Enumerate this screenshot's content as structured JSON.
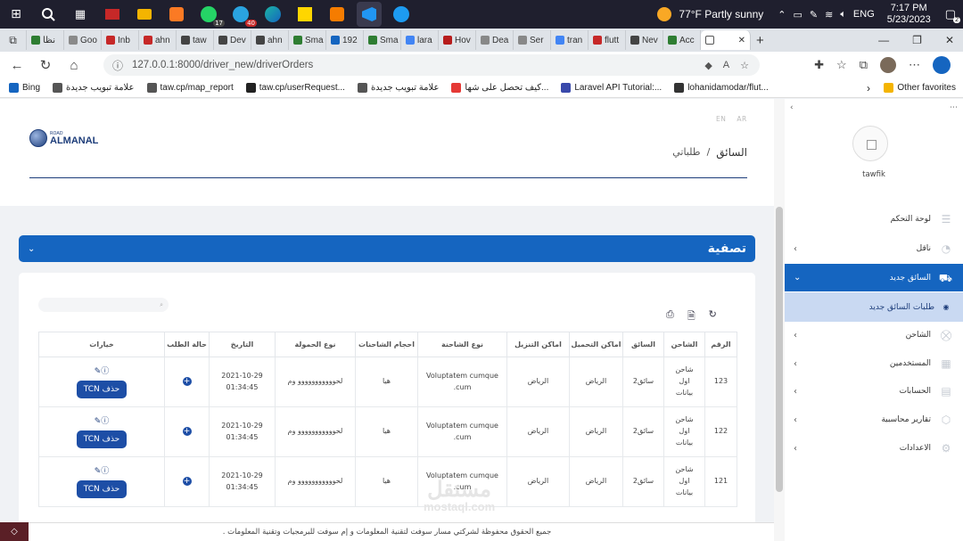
{
  "taskbar": {
    "icons": [
      "windows-icon",
      "search-icon",
      "task-view-icon",
      "app-icon",
      "file-explorer-icon",
      "xampp-icon",
      "whatsapp-icon",
      "telegram-icon",
      "edge-icon",
      "sticky-notes-icon",
      "office-icon",
      "vscode-icon",
      "twitter-icon"
    ],
    "whatsapp_badge": "17",
    "telegram_badge": "40",
    "weather": "77°F  Partly sunny",
    "lang": "ENG",
    "time": "7:17 PM",
    "date": "5/23/2023",
    "notif_badge": "2"
  },
  "tabs": [
    {
      "label": "نظا",
      "color": "#2e7d32"
    },
    {
      "label": "Goo",
      "color": "#8a8a8a"
    },
    {
      "label": "Inb",
      "color": "#c62828"
    },
    {
      "label": "ahn",
      "color": "#c62828"
    },
    {
      "label": "taw",
      "color": "#444"
    },
    {
      "label": "Dev",
      "color": "#444"
    },
    {
      "label": "ahn",
      "color": "#444"
    },
    {
      "label": "Sma",
      "color": "#2e7d32"
    },
    {
      "label": "192",
      "color": "#1565c0"
    },
    {
      "label": "Sma",
      "color": "#2e7d32"
    },
    {
      "label": "lara",
      "color": "#4285f4"
    },
    {
      "label": "Hov",
      "color": "#b71c1c"
    },
    {
      "label": "Dea",
      "color": "#888"
    },
    {
      "label": "Ser",
      "color": "#888"
    },
    {
      "label": "tran",
      "color": "#4285f4"
    },
    {
      "label": "flutt",
      "color": "#c62828"
    },
    {
      "label": "Nev",
      "color": "#444"
    },
    {
      "label": "Acc",
      "color": "#2e7d32"
    },
    {
      "label": "",
      "color": "#fff"
    }
  ],
  "address": {
    "url": "127.0.0.1:8000/driver_new/driverOrders"
  },
  "bookmarks": [
    {
      "label": "Bing",
      "color": "#1565c0"
    },
    {
      "label": "علامة تبويب جديدة",
      "color": "#555"
    },
    {
      "label": "taw.cp/map_report",
      "color": "#555"
    },
    {
      "label": "taw.cp/userRequest...",
      "color": "#222"
    },
    {
      "label": "علامة تبويب جديدة",
      "color": "#555"
    },
    {
      "label": "كيف تحصل على شها...",
      "color": "#e53935"
    },
    {
      "label": "Laravel API Tutorial:...",
      "color": "#3949ab"
    },
    {
      "label": "lohanidamodar/flut...",
      "color": "#333"
    }
  ],
  "other_favorites": "Other favorites",
  "header": {
    "lang_en": "EN",
    "lang_ar": "AR",
    "logo_small": "ROAD",
    "logo_text": "ALMANAL",
    "breadcrumb_root": "السائق",
    "breadcrumb_sep": "/",
    "breadcrumb_current": "طلباتي"
  },
  "filter": {
    "title": "تصفية"
  },
  "table": {
    "headers": [
      "الرقم",
      "الشاحن",
      "السائق",
      "اماكن التحميل",
      "اماكن التنزيل",
      "نوع الشاحنة",
      "احجام الشاحنات",
      "نوع الحمولة",
      "التاريخ",
      "حالة الطلب",
      "خيارات"
    ],
    "rows": [
      {
        "id": "123",
        "shipper": "شاحن اول بيانات",
        "driver": "سائق2",
        "load": "الرياض",
        "unload": "الرياض",
        "truck_type": "Voluptatem cumque .cum",
        "sizes": "هيا",
        "cargo": "لحووووووووووو وم",
        "date": "2021-10-29 01:34:45"
      },
      {
        "id": "122",
        "shipper": "شاحن اول بيانات",
        "driver": "سائق2",
        "load": "الرياض",
        "unload": "الرياض",
        "truck_type": "Voluptatem cumque .cum",
        "sizes": "هيا",
        "cargo": "لحووووووووووو وم",
        "date": "2021-10-29 01:34:45"
      },
      {
        "id": "121",
        "shipper": "شاحن اول بيانات",
        "driver": "سائق2",
        "load": "الرياض",
        "unload": "الرياض",
        "truck_type": "Voluptatem cumque .cum",
        "sizes": "هيا",
        "cargo": "لحووووووووووو وم",
        "date": "2021-10-29 01:34:45"
      }
    ],
    "delete_label": "حذف TCN"
  },
  "watermark": {
    "line1": "مستقل",
    "line2": "mostaql.com"
  },
  "footer": {
    "text": "جميع الحقوق محفوظة لشركتي مسار سوفت لتقنية المعلومات و إم سوفت للبرمجيات وتقنية المعلومات ."
  },
  "sidebar": {
    "username": "tawfik",
    "items": [
      {
        "label": "لوحة التحكم",
        "icon": "dashboard-icon"
      },
      {
        "label": "ناقل",
        "icon": "carrier-icon"
      },
      {
        "label": "السائق جديد",
        "icon": "truck-icon"
      },
      {
        "label": "طلبات السائق جديد",
        "icon": "dot-icon"
      },
      {
        "label": "الشاحن",
        "icon": "cart-icon"
      },
      {
        "label": "المستخدمين",
        "icon": "users-icon"
      },
      {
        "label": "الحسابات",
        "icon": "accounts-icon"
      },
      {
        "label": "تقارير محاسبية",
        "icon": "reports-icon"
      },
      {
        "label": "الاعدادات",
        "icon": "settings-icon"
      }
    ]
  },
  "colors": {
    "accent": "#1565c0",
    "brand": "#1d3d7a",
    "active_sub": "#c9d9f2"
  }
}
